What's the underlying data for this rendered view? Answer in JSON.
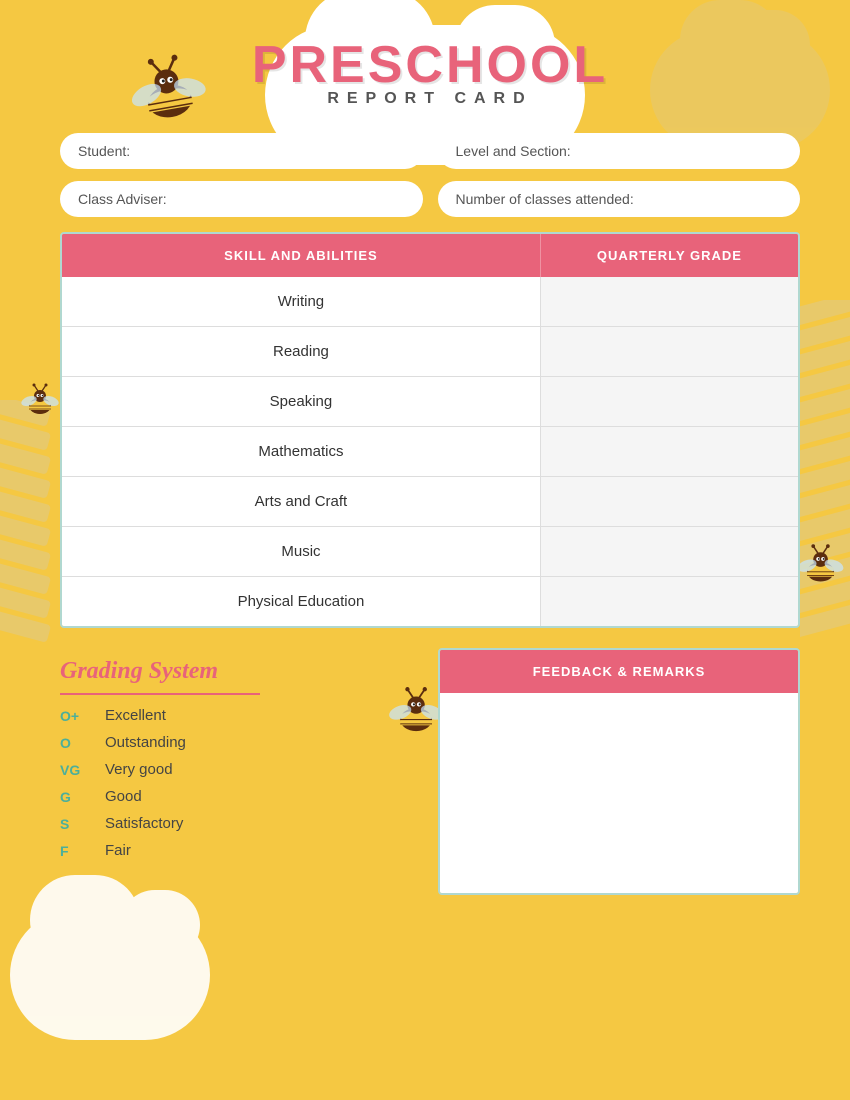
{
  "page": {
    "background_color": "#F5C842",
    "title": "PRESCHOOL",
    "subtitle": "REPORT CARD"
  },
  "form": {
    "student_label": "Student:",
    "level_label": "Level and Section:",
    "adviser_label": "Class Adviser:",
    "classes_label": "Number of classes attended:"
  },
  "table": {
    "col1_header": "SKILL AND ABILITIES",
    "col2_header": "QUARTERLY GRADE",
    "rows": [
      {
        "subject": "Writing",
        "grade": ""
      },
      {
        "subject": "Reading",
        "grade": ""
      },
      {
        "subject": "Speaking",
        "grade": ""
      },
      {
        "subject": "Mathematics",
        "grade": ""
      },
      {
        "subject": "Arts and Craft",
        "grade": ""
      },
      {
        "subject": "Music",
        "grade": ""
      },
      {
        "subject": "Physical Education",
        "grade": ""
      }
    ]
  },
  "grading": {
    "title": "Grading System",
    "items": [
      {
        "code": "O+",
        "label": "Excellent"
      },
      {
        "code": "O",
        "label": "Outstanding"
      },
      {
        "code": "VG",
        "label": "Very good"
      },
      {
        "code": "G",
        "label": "Good"
      },
      {
        "code": "S",
        "label": "Satisfactory"
      },
      {
        "code": "F",
        "label": "Fair"
      }
    ]
  },
  "feedback": {
    "header": "FEEDBACK & REMARKS",
    "content": ""
  }
}
